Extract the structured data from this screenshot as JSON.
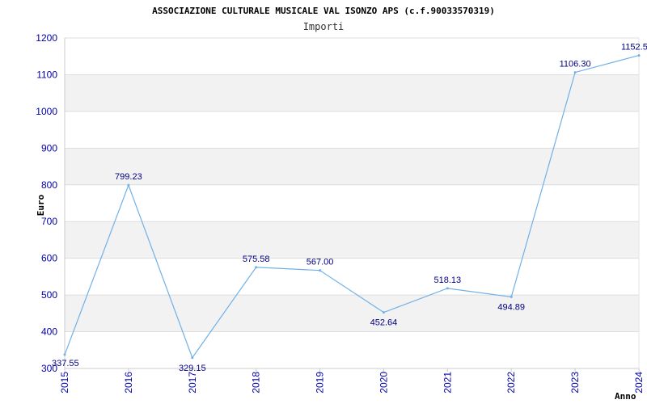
{
  "chart_data": {
    "type": "line",
    "title": "ASSOCIAZIONE CULTURALE MUSICALE VAL ISONZO APS (c.f.90033570319)",
    "subtitle": "Importi",
    "xlabel": "Anno",
    "ylabel": "Euro",
    "x": [
      "2015",
      "2016",
      "2017",
      "2018",
      "2019",
      "2020",
      "2021",
      "2022",
      "2023",
      "2024"
    ],
    "series": [
      {
        "values": [
          337.55,
          799.23,
          329.15,
          575.58,
          567.0,
          452.64,
          518.13,
          494.89,
          1106.3,
          1152.5
        ],
        "labels": [
          "337.55",
          "799.23",
          "329.15",
          "575.58",
          "567.00",
          "452.64",
          "518.13",
          "494.89",
          "1106.30",
          "1152.5"
        ]
      }
    ],
    "ylim": [
      300,
      1200
    ],
    "yticks": [
      300,
      400,
      500,
      600,
      700,
      800,
      900,
      1000,
      1100,
      1200
    ],
    "grid": true,
    "colors": {
      "line": "#6fb1e8",
      "tick_text": "#0000aa",
      "data_label": "#000080",
      "band": "#f2f2f2",
      "grid": "#dddddd"
    }
  }
}
